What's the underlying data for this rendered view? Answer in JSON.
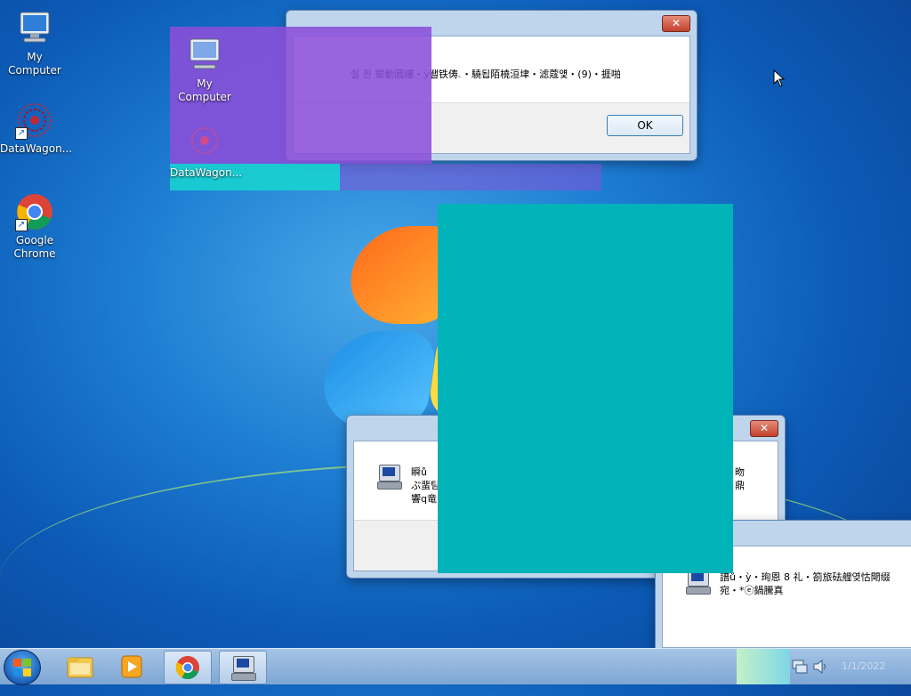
{
  "desktop": {
    "icons": [
      {
        "label": "My Computer",
        "icon": "computer-icon"
      },
      {
        "label": "DataWagon...",
        "icon": "datawagon-icon"
      },
      {
        "label": "Google Chrome",
        "icon": "chrome-icon"
      }
    ],
    "ghost_icons": [
      {
        "label": "My Computer"
      },
      {
        "label": "DataWagon..."
      }
    ]
  },
  "dialog_top": {
    "message": "춸 죈 蜀動圓縷・ỳ뙐铁俦ۦ・驍됩陌橈洹垏・滤蔻얯・(9)・捱啪",
    "ok_label": "OK",
    "close_label": "✕"
  },
  "dialog_mid": {
    "close_label": "✕",
    "line1": "瞬ů",
    "line2": "ぷ蜚팀",
    "line3": "響q竜",
    "right1": "昒",
    "right2": "鼎"
  },
  "dialog_bottom": {
    "line1": "譜ů・ỳ・珣恩 8 礼・箚旅砝艃옂怙閜缀",
    "line2": "宛・*ⓔ鍋騰真"
  },
  "tray": {
    "clock": "1/1/2022"
  },
  "colors": {
    "overlay_purple": "#8b4fd8",
    "overlay_teal": "#00b3b8"
  }
}
